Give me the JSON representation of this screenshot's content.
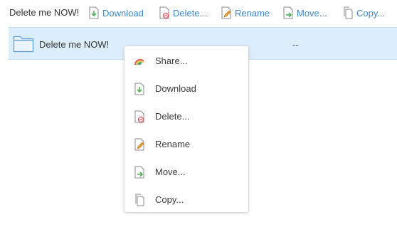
{
  "toolbar": {
    "title": "Delete me NOW!",
    "buttons": [
      {
        "label": "Download",
        "icon": "download-icon"
      },
      {
        "label": "Delete...",
        "icon": "delete-icon"
      },
      {
        "label": "Rename",
        "icon": "rename-icon"
      },
      {
        "label": "Move...",
        "icon": "move-icon"
      },
      {
        "label": "Copy...",
        "icon": "copy-icon"
      }
    ]
  },
  "file_row": {
    "name": "Delete me NOW!",
    "size": "--",
    "icon": "folder-icon"
  },
  "context_menu": {
    "items": [
      {
        "label": "Share...",
        "icon": "share-icon"
      },
      {
        "label": "Download",
        "icon": "download-icon"
      },
      {
        "label": "Delete...",
        "icon": "delete-icon"
      },
      {
        "label": "Rename",
        "icon": "rename-icon"
      },
      {
        "label": "Move...",
        "icon": "move-icon"
      },
      {
        "label": "Copy...",
        "icon": "copy-icon"
      }
    ]
  },
  "colors": {
    "link": "#3a86c8",
    "selection": "#dceefb",
    "download_arrow": "#4caf50",
    "delete_badge": "#e05a5a",
    "rename_pencil": "#e8a23a",
    "move_arrow": "#4caf50"
  }
}
